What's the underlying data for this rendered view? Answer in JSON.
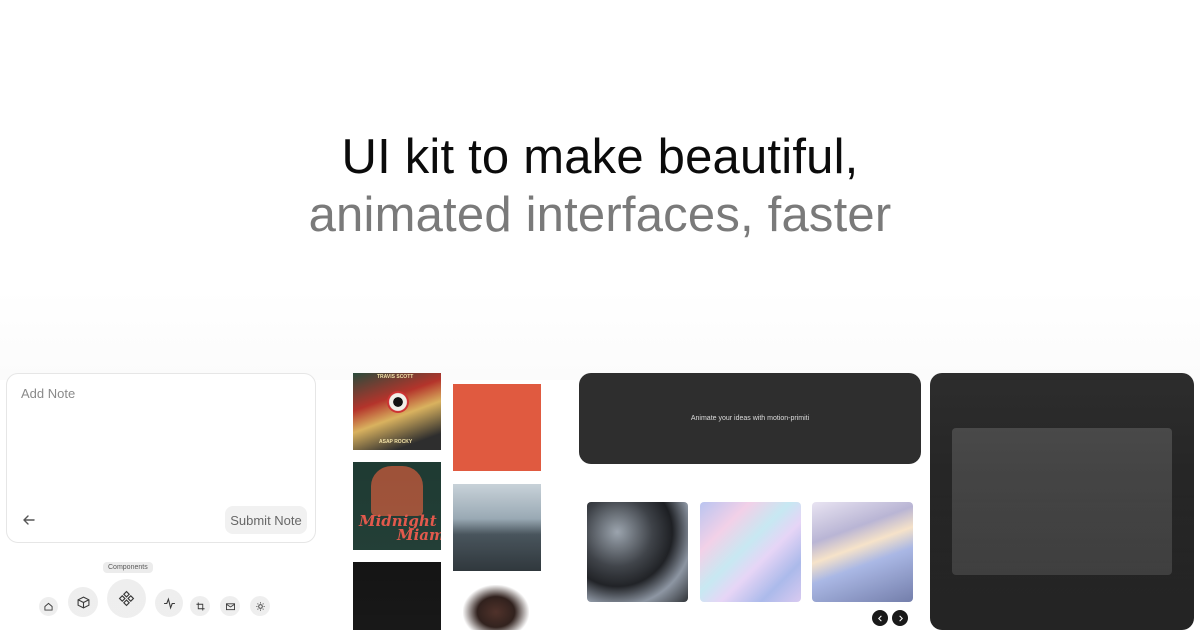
{
  "hero": {
    "line1": "UI kit to make beautiful,",
    "line2": "animated interfaces, faster"
  },
  "note_card": {
    "placeholder": "Add Note",
    "back_icon": "arrow-left-icon",
    "submit_label": "Submit Note"
  },
  "dock": {
    "tooltip": "Components",
    "items": [
      {
        "icon": "home-icon"
      },
      {
        "icon": "box-icon"
      },
      {
        "icon": "components-icon"
      },
      {
        "icon": "activity-icon"
      },
      {
        "icon": "crop-icon"
      },
      {
        "icon": "mail-icon"
      },
      {
        "icon": "sun-icon"
      }
    ]
  },
  "albums": {
    "travis": {
      "top_text": "TRAVIS SCOTT",
      "bottom_text": "ASAP ROCKY"
    },
    "midnight": {
      "line1": "Midnight",
      "line2": "Miami"
    }
  },
  "dark_card": {
    "text": "Animate your ideas with motion-primiti"
  },
  "carousel": {
    "prev_icon": "chevron-left-icon",
    "next_icon": "chevron-right-icon"
  },
  "colors": {
    "hero_primary": "#0b0b0b",
    "hero_secondary": "#7a7a7a",
    "dark_card": "#2e2e2e",
    "red_album": "#e05a40"
  }
}
